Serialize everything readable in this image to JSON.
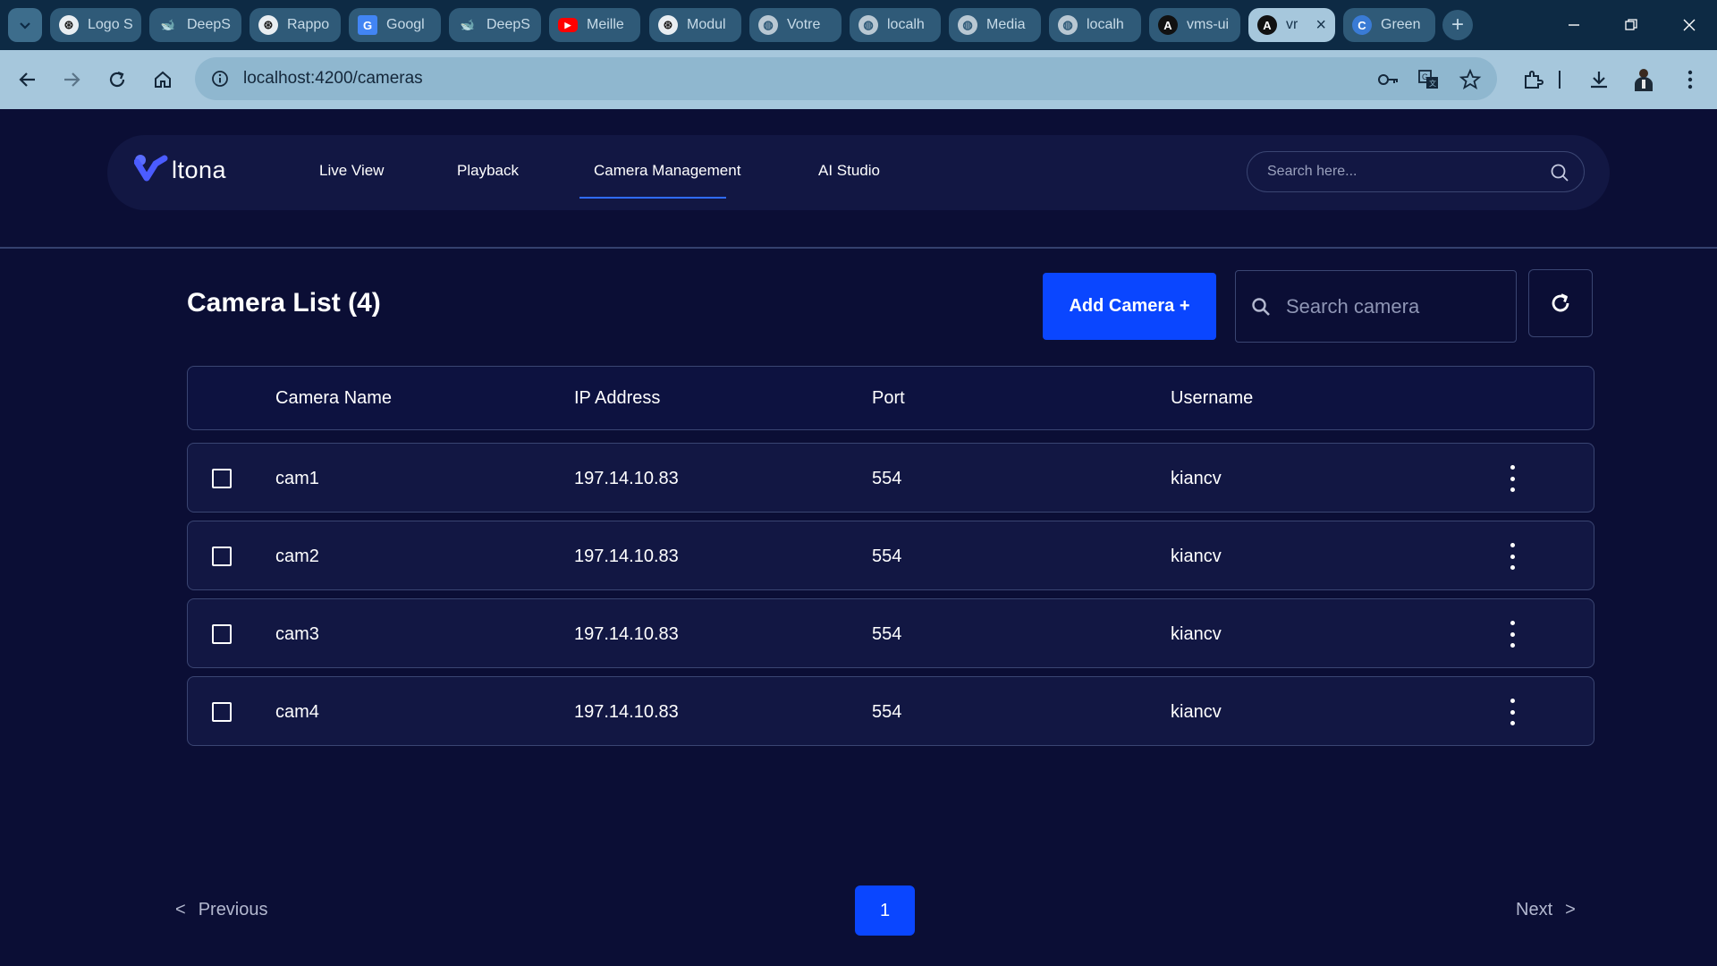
{
  "browser": {
    "tabs": [
      {
        "title": "Logo S",
        "icon": "openai-icon"
      },
      {
        "title": "DeepS",
        "icon": "deepseek-icon"
      },
      {
        "title": "Rappo",
        "icon": "openai-icon"
      },
      {
        "title": "Googl",
        "icon": "google-translate-icon"
      },
      {
        "title": "DeepS",
        "icon": "deepseek-icon"
      },
      {
        "title": "Meille",
        "icon": "youtube-icon"
      },
      {
        "title": "Modul",
        "icon": "openai-icon"
      },
      {
        "title": "Votre",
        "icon": "globe-icon"
      },
      {
        "title": "localh",
        "icon": "globe-icon"
      },
      {
        "title": "Media",
        "icon": "globe-icon"
      },
      {
        "title": "localh",
        "icon": "globe-icon"
      },
      {
        "title": "vms-ui",
        "icon": "angular-icon"
      },
      {
        "title": "vr",
        "icon": "angular-icon",
        "active": true
      },
      {
        "title": "Green",
        "icon": "canva-icon"
      }
    ],
    "url": "localhost:4200/cameras"
  },
  "app": {
    "logo_text": "ltona",
    "nav": {
      "live_view": "Live View",
      "playback": "Playback",
      "camera_management": "Camera Management",
      "ai_studio": "AI Studio",
      "active": "camera_management"
    },
    "search_placeholder": "Search here..."
  },
  "main": {
    "title": "Camera List (4)",
    "add_button": "Add Camera +",
    "search_placeholder": "Search camera",
    "table": {
      "headers": {
        "name": "Camera Name",
        "ip": "IP Address",
        "port": "Port",
        "username": "Username"
      },
      "rows": [
        {
          "name": "cam1",
          "ip": "197.14.10.83",
          "port": "554",
          "username": "kiancv"
        },
        {
          "name": "cam2",
          "ip": "197.14.10.83",
          "port": "554",
          "username": "kiancv"
        },
        {
          "name": "cam3",
          "ip": "197.14.10.83",
          "port": "554",
          "username": "kiancv"
        },
        {
          "name": "cam4",
          "ip": "197.14.10.83",
          "port": "554",
          "username": "kiancv"
        }
      ]
    },
    "pagination": {
      "previous": "Previous",
      "next": "Next",
      "current_page": "1"
    }
  },
  "colors": {
    "background": "#0b0e35",
    "accent": "#0a46ff",
    "browser_toolbar": "#a6c7dc",
    "tabbar": "#0d2a44"
  }
}
